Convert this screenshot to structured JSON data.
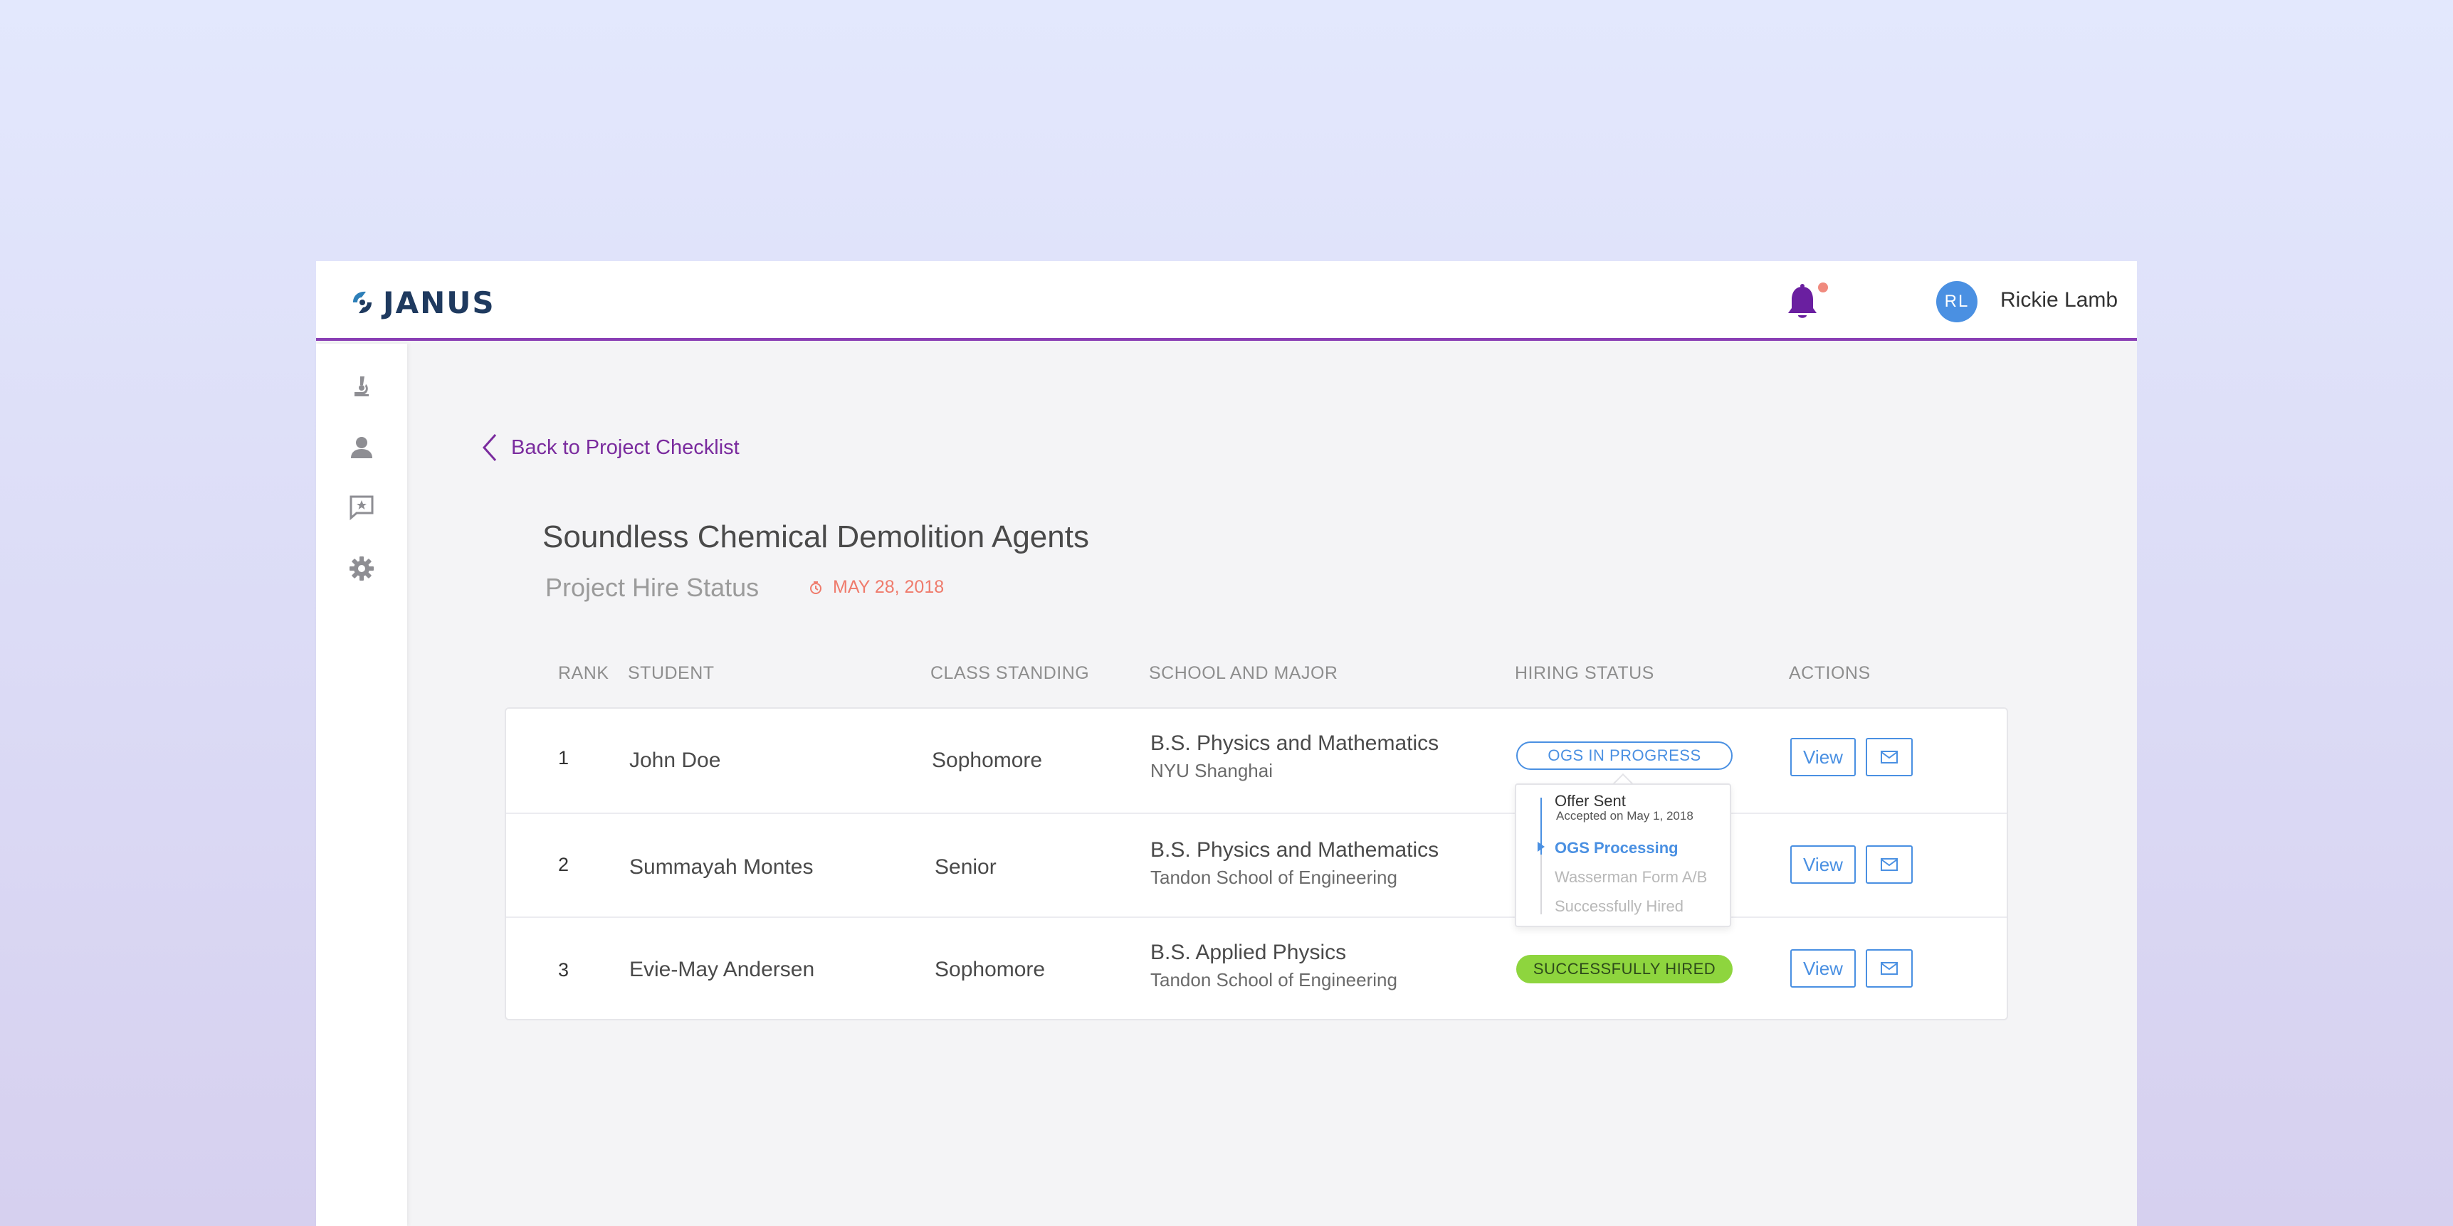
{
  "brand": {
    "name": "JANUS"
  },
  "user": {
    "initials": "RL",
    "name": "Rickie Lamb"
  },
  "colors": {
    "accent": "#8a3fb5",
    "primary": "#4a90e2",
    "success": "#8ed53e",
    "date": "#ef7b6c"
  },
  "sidebar": {
    "items": [
      {
        "icon": "microscope-icon"
      },
      {
        "icon": "user-icon"
      },
      {
        "icon": "feedback-icon"
      },
      {
        "icon": "gear-icon"
      }
    ]
  },
  "nav": {
    "back_label": "Back to Project Checklist"
  },
  "page": {
    "title": "Soundless Chemical Demolition Agents",
    "subtitle": "Project Hire Status",
    "date": "MAY 28, 2018"
  },
  "table": {
    "headers": {
      "rank": "RANK",
      "student": "STUDENT",
      "class": "CLASS STANDING",
      "school": "SCHOOL AND MAJOR",
      "status": "HIRING STATUS",
      "actions": "ACTIONS"
    },
    "rows": [
      {
        "rank": "1",
        "student": "John Doe",
        "class": "Sophomore",
        "major": "B.S. Physics and Mathematics",
        "school": "NYU Shanghai",
        "status": "OGS IN PROGRESS",
        "view": "View"
      },
      {
        "rank": "2",
        "student": "Summayah Montes",
        "class": "Senior",
        "major": "B.S. Physics and Mathematics",
        "school": "Tandon School of Engineering",
        "status": "",
        "view": "View"
      },
      {
        "rank": "3",
        "student": "Evie-May Andersen",
        "class": "Sophomore",
        "major": "B.S. Applied Physics",
        "school": "Tandon School of Engineering",
        "status": "SUCCESSFULLY HIRED",
        "view": "View"
      }
    ]
  },
  "status_popover": {
    "steps": [
      {
        "label": "Offer Sent",
        "note": "Accepted on May 1, 2018",
        "state": "done"
      },
      {
        "label": "OGS Processing",
        "state": "active"
      },
      {
        "label": "Wasserman Form A/B",
        "state": "pending"
      },
      {
        "label": "Successfully Hired",
        "state": "pending"
      }
    ]
  }
}
